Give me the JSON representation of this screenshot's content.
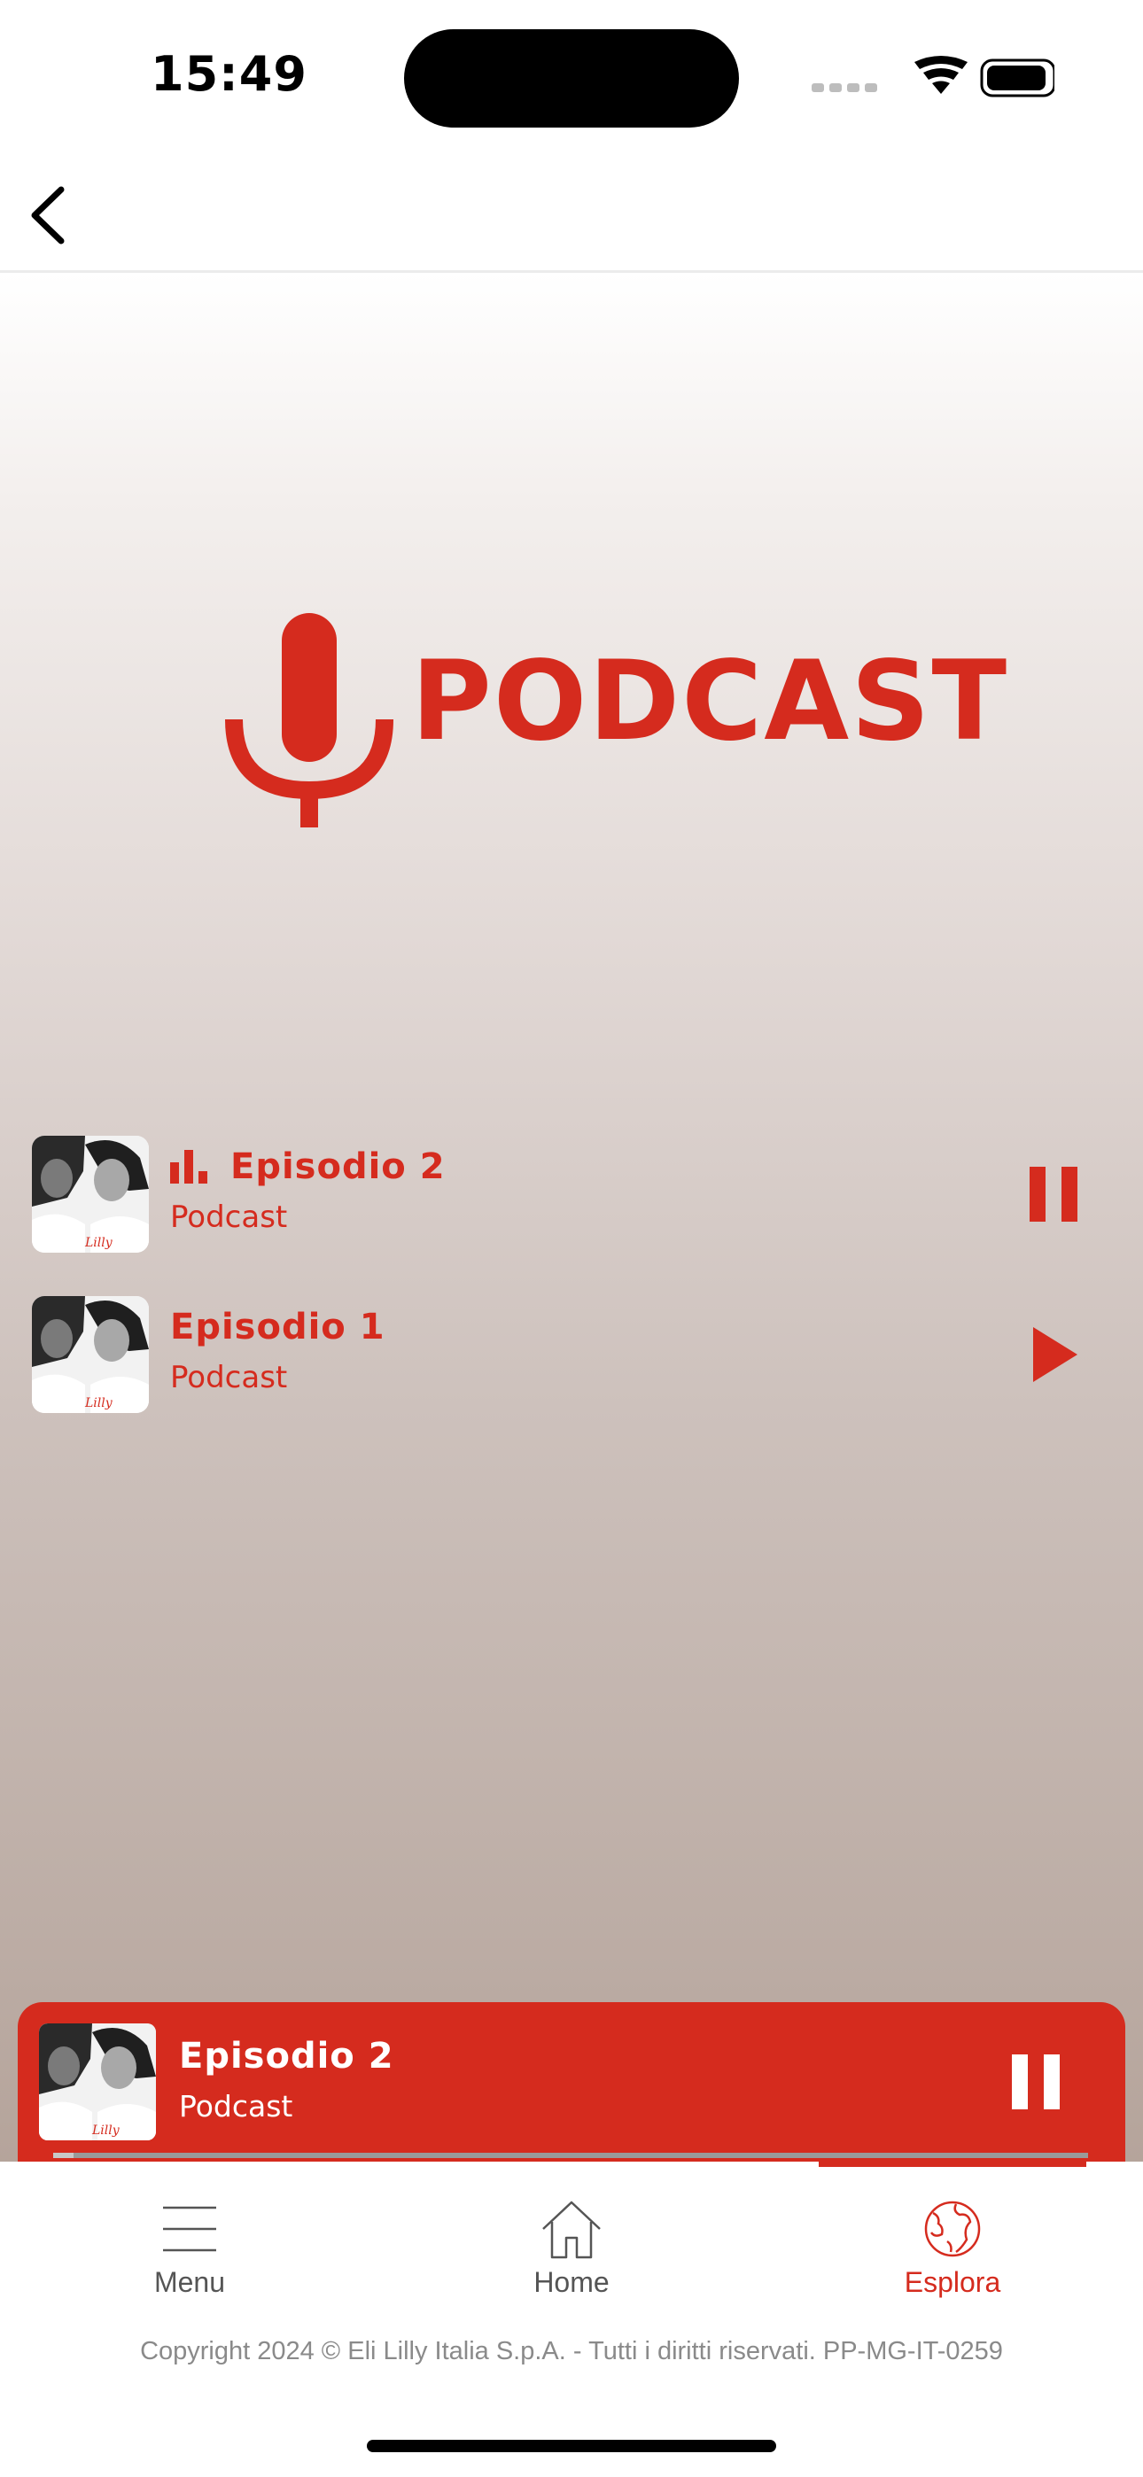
{
  "status_bar": {
    "time": "15:49"
  },
  "header": {
    "back_icon": "chevron-left-icon"
  },
  "logo": {
    "text": "PODCAST",
    "icon": "microphone-icon"
  },
  "episodes": [
    {
      "title": "Episodio 2",
      "subtitle": "Podcast",
      "playing": true,
      "action_icon": "pause-icon"
    },
    {
      "title": "Episodio 1",
      "subtitle": "Podcast",
      "playing": false,
      "action_icon": "play-icon"
    }
  ],
  "mini_player": {
    "title": "Episodio 2",
    "subtitle": "Podcast",
    "action_icon": "pause-icon",
    "progress": 0.02
  },
  "tabs": [
    {
      "label": "Menu",
      "icon": "hamburger-menu-icon",
      "active": false
    },
    {
      "label": "Home",
      "icon": "home-icon",
      "active": false
    },
    {
      "label": "Esplora",
      "icon": "globe-icon",
      "active": true
    }
  ],
  "footer": {
    "copyright": "Copyright 2024 © Eli Lilly Italia S.p.A. - Tutti i diritti riservati. PP-MG-IT-0259"
  },
  "colors": {
    "accent": "#d52b1e",
    "tab_inactive": "#555555",
    "footer_text": "#8a8a8a"
  }
}
